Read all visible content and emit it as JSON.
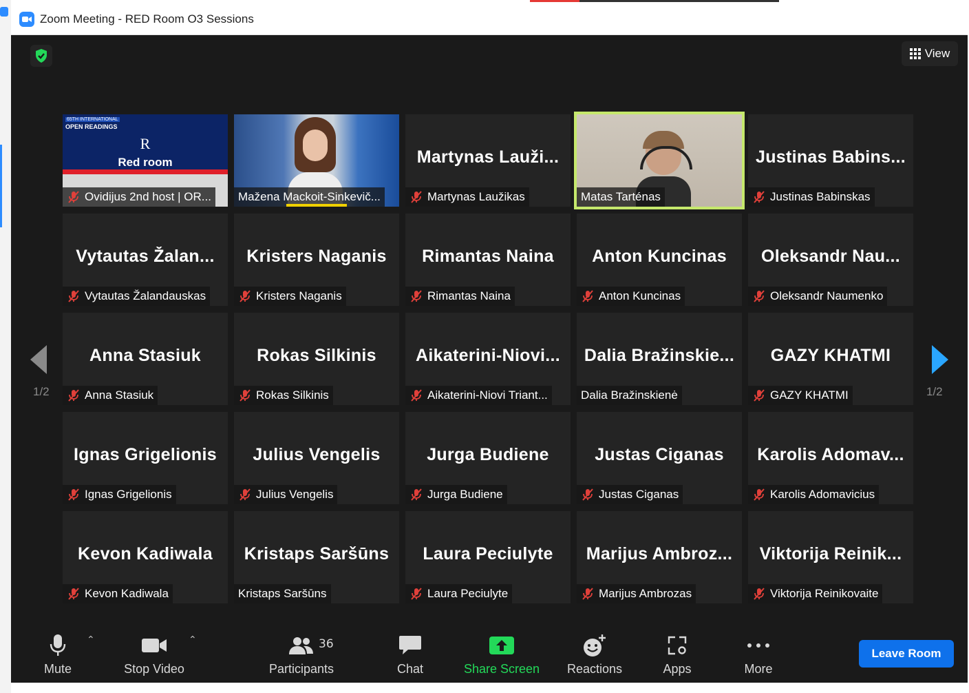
{
  "window": {
    "title": "Zoom Meeting - RED Room O3 Sessions"
  },
  "header": {
    "view_label": "View"
  },
  "pagination": {
    "left": "1/2",
    "right": "1/2"
  },
  "slide": {
    "line1": "65TH INTERNATIONAL",
    "line2": "OPEN READINGS",
    "room": "Red room",
    "logo": "R"
  },
  "tiles": [
    {
      "big": "",
      "name": "Ovidijus 2nd host | OR..."
    },
    {
      "big": "",
      "name": "Mažena Mackoit-Sinkevič..."
    },
    {
      "big": "Martynas  Lauži...",
      "name": "Martynas Laužikas"
    },
    {
      "big": "",
      "name": "Matas Tarténas"
    },
    {
      "big": "Justinas  Babins...",
      "name": "Justinas Babinskas"
    },
    {
      "big": "Vytautas  Žalan...",
      "name": "Vytautas Žalandauskas"
    },
    {
      "big": "Kristers Naganis",
      "name": "Kristers Naganis"
    },
    {
      "big": "Rimantas Naina",
      "name": "Rimantas Naina"
    },
    {
      "big": "Anton Kuncinas",
      "name": "Anton Kuncinas"
    },
    {
      "big": "Oleksandr  Nau...",
      "name": "Oleksandr Naumenko"
    },
    {
      "big": "Anna Stasiuk",
      "name": "Anna Stasiuk"
    },
    {
      "big": "Rokas Silkinis",
      "name": "Rokas Silkinis"
    },
    {
      "big": "Aikaterini-Niovi...",
      "name": "Aikaterini-Niovi Triant..."
    },
    {
      "big": "Dalia  Bražinskie...",
      "name": "Dalia Bražinskienė"
    },
    {
      "big": "GAZY KHATMI",
      "name": "GAZY KHATMI"
    },
    {
      "big": "Ignas Grigelionis",
      "name": "Ignas Grigelionis"
    },
    {
      "big": "Julius Vengelis",
      "name": "Julius Vengelis"
    },
    {
      "big": "Jurga Budiene",
      "name": "Jurga Budiene"
    },
    {
      "big": "Justas Ciganas",
      "name": "Justas Ciganas"
    },
    {
      "big": "Karolis  Adomav...",
      "name": "Karolis Adomavicius"
    },
    {
      "big": "Kevon Kadiwala",
      "name": "Kevon Kadiwala"
    },
    {
      "big": "Kristaps Saršūns",
      "name": "Kristaps Saršūns"
    },
    {
      "big": "Laura Peciulyte",
      "name": "Laura Peciulyte"
    },
    {
      "big": "Marijus  Ambroz...",
      "name": "Marijus Ambrozas"
    },
    {
      "big": "Viktorija  Reinik...",
      "name": "Viktorija Reinikovaite"
    }
  ],
  "toolbar": {
    "mute": "Mute",
    "stop_video": "Stop Video",
    "participants": "Participants",
    "participants_count": "36",
    "chat": "Chat",
    "share_screen": "Share Screen",
    "reactions": "Reactions",
    "apps": "Apps",
    "more": "More",
    "leave": "Leave Room"
  },
  "colors": {
    "accent": "#0e71eb",
    "share": "#23d959",
    "muted": "#e0403a",
    "speaking": "#c5e86c"
  }
}
